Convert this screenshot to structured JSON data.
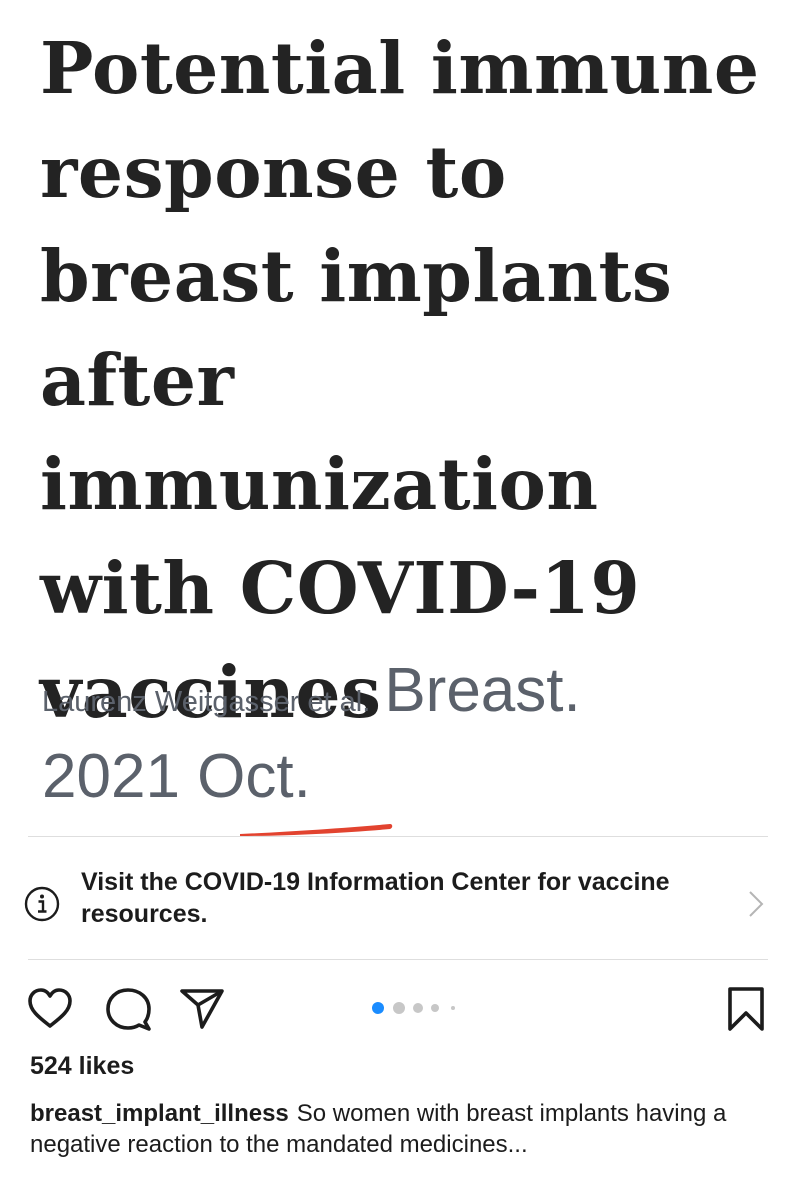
{
  "article": {
    "title": "Potential immune response to breast implants after immunization with COVID-19 vaccines",
    "authors": "Laurenz Weitgasser et al.",
    "journal": "Breast.",
    "date": "2021 Oct."
  },
  "info_banner": {
    "text": "Visit the COVID-19 Information Center for vaccine resources.",
    "icon": "info-icon"
  },
  "actions": {
    "like_icon": "heart-icon",
    "comment_icon": "comment-icon",
    "share_icon": "paper-plane-icon",
    "save_icon": "bookmark-icon"
  },
  "carousel": {
    "total_visible_dots": 5,
    "active_index": 0,
    "active_color": "#1a8cff"
  },
  "likes_text": "524 likes",
  "caption": {
    "username": "breast_implant_illness",
    "text": "So women with breast implants having a negative reaction to the mandated medicines..."
  },
  "colors": {
    "accent_red": "#e2432f",
    "muted_gray": "#5b616b"
  }
}
